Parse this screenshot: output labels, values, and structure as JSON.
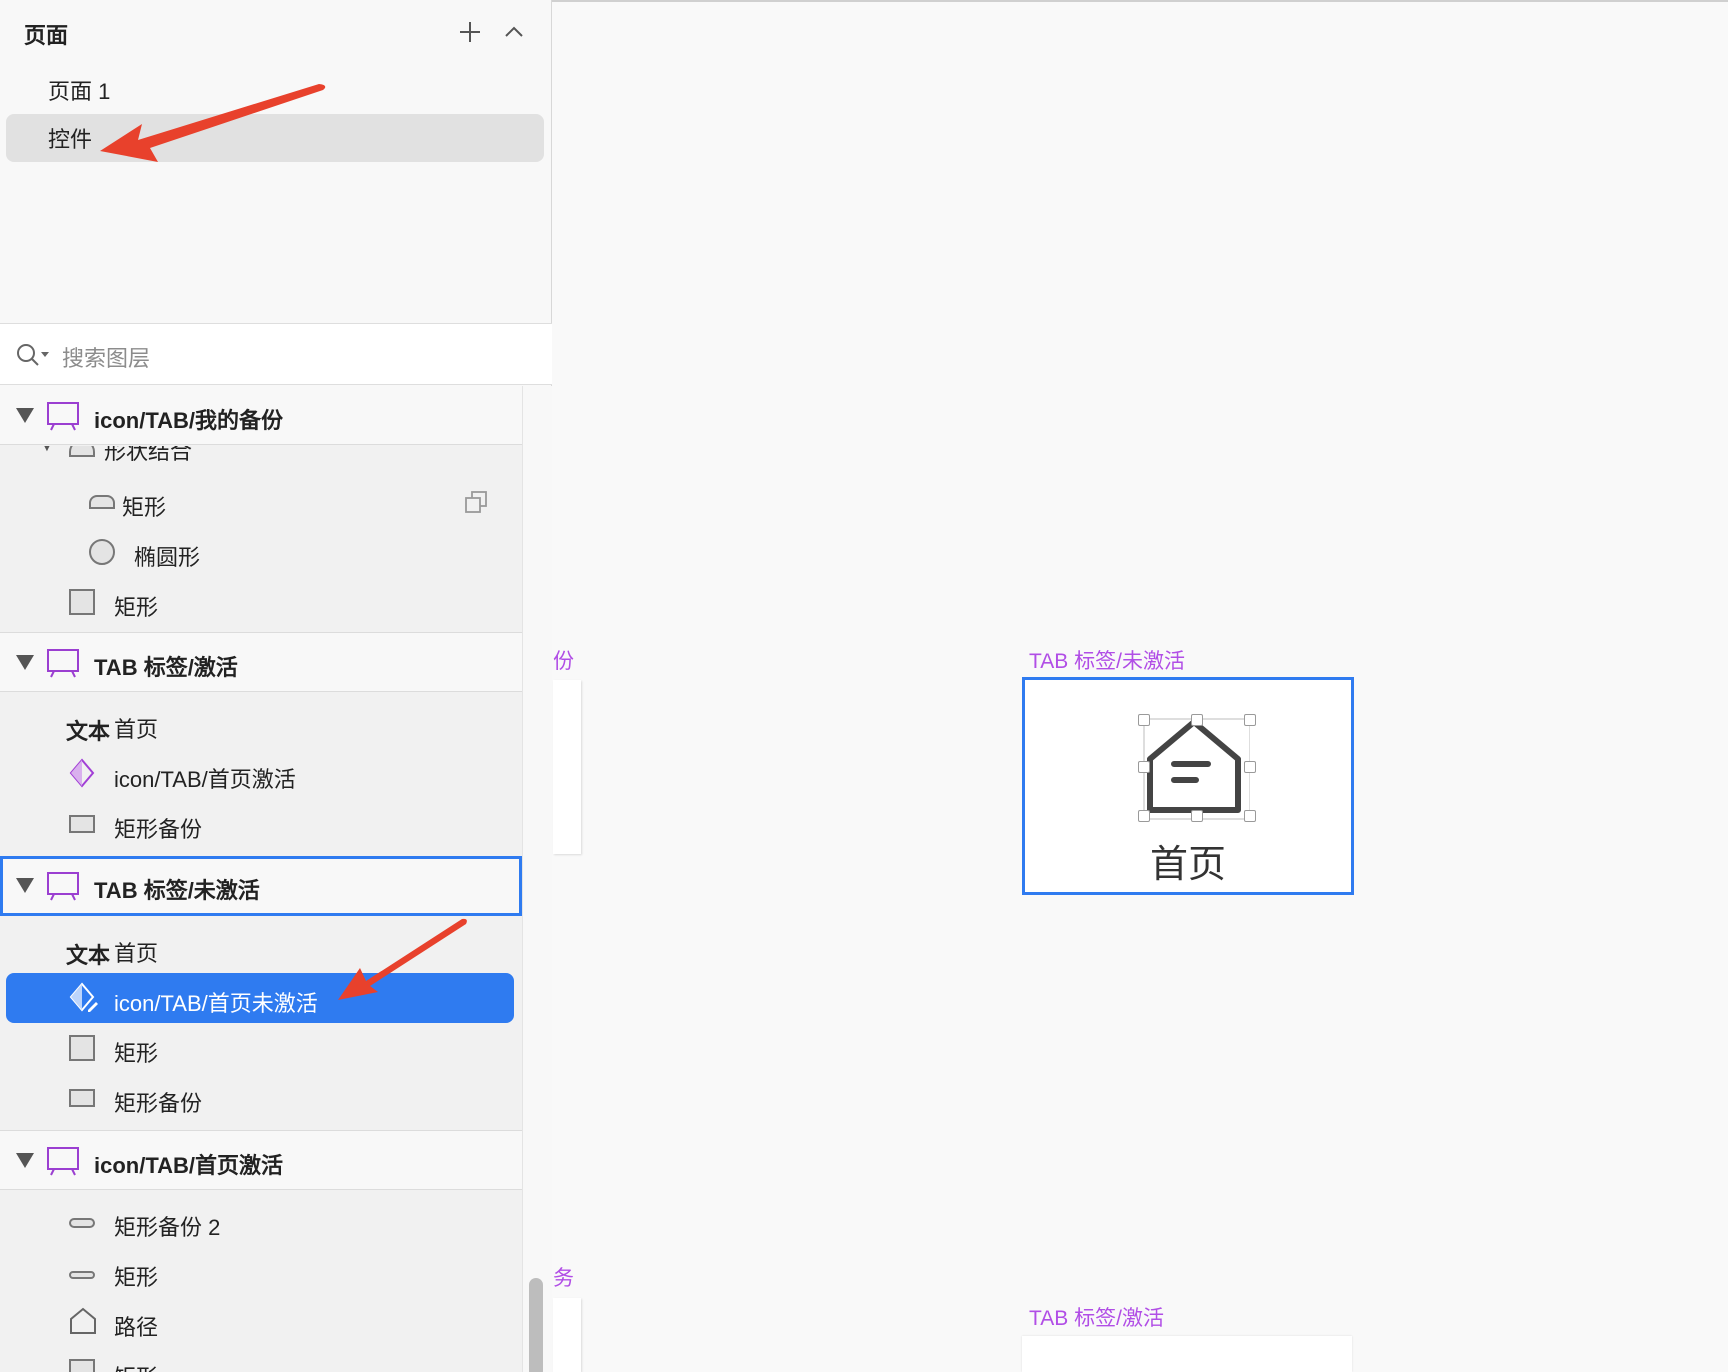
{
  "pages_panel": {
    "title": "页面",
    "add_icon": "plus-icon",
    "collapse_icon": "chevron-up-icon",
    "pages": [
      {
        "label": "页面 1",
        "selected": false
      },
      {
        "label": "控件",
        "selected": true
      }
    ]
  },
  "search": {
    "placeholder": "搜索图层",
    "icon": "search-icon"
  },
  "layers": {
    "group_backup": {
      "label": "icon/TAB/我的备份"
    },
    "shape_combo": {
      "label": "形状结合"
    },
    "rect_1": {
      "label": "矩形"
    },
    "ellipse": {
      "label": "椭圆形"
    },
    "rect_2": {
      "label": "矩形"
    },
    "group_tab_active": {
      "label": "TAB 标签/激活"
    },
    "text_tag_1": "文本",
    "text_home_1": {
      "label": "首页"
    },
    "symbol_home_active": {
      "label": "icon/TAB/首页激活"
    },
    "rect_backup_1": {
      "label": "矩形备份"
    },
    "group_tab_inactive": {
      "label": "TAB 标签/未激活"
    },
    "text_tag_2": "文本",
    "text_home_2": {
      "label": "首页"
    },
    "symbol_home_inactive": {
      "label": "icon/TAB/首页未激活"
    },
    "rect_3": {
      "label": "矩形"
    },
    "rect_backup_2": {
      "label": "矩形备份"
    },
    "group_home_active": {
      "label": "icon/TAB/首页激活"
    },
    "rect_backup_3": {
      "label": "矩形备份 2"
    },
    "rect_4": {
      "label": "矩形"
    },
    "path": {
      "label": "路径"
    },
    "rect_5": {
      "label": "矩形"
    }
  },
  "canvas": {
    "partial_label_1": "份",
    "partial_label_2": "务",
    "tab_inactive_title": "TAB 标签/未激活",
    "tab_inactive_text": "首页",
    "tab_active_title": "TAB 标签/激活",
    "home_icon": "home-icon"
  },
  "colors": {
    "selection_blue": "#2f7bf0",
    "symbol_purple": "#a23fd6",
    "artboard_label_purple": "#b14ee6",
    "annotation_red": "#e8412c"
  }
}
